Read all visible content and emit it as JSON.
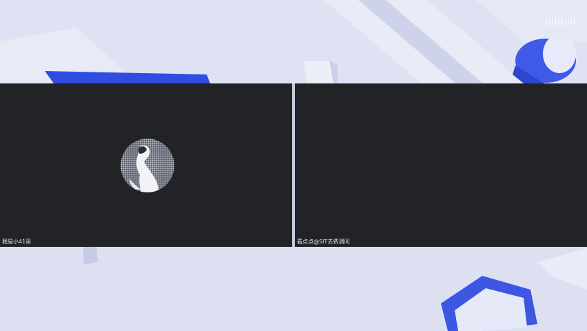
{
  "watermark": {
    "text": "bilibili"
  },
  "participants": [
    {
      "name": "我是小41哥",
      "avatar_icon": "user-avatar-icon",
      "camera_on": false
    },
    {
      "name": "看点点@SIT去费测问",
      "camera_on": false
    }
  ],
  "colors": {
    "background": "#dfe2f2",
    "tile_background": "#212326",
    "accent_blue": "#2f4de0",
    "name_text": "#e6e6e6"
  }
}
